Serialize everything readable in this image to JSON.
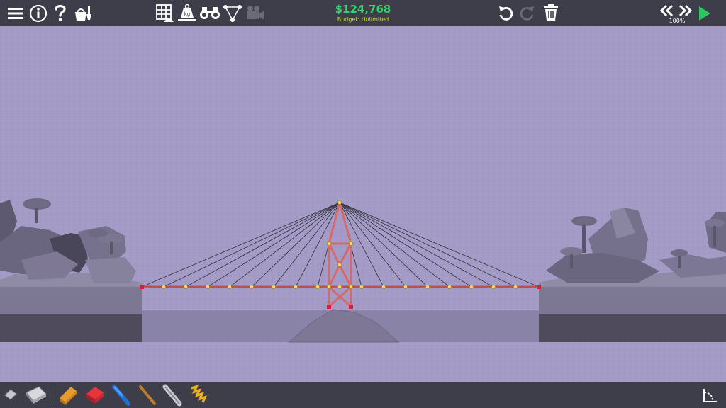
{
  "toolbar": {
    "budget_amount": "$124,768",
    "budget_label": "Budget: Unlimited",
    "speed": "100%"
  },
  "colors": {
    "bar_bg": "#3e3d4a",
    "sky": "#a49cc6",
    "road": "#c0504d",
    "steel": "#d46a6a",
    "joint": "#f1e23a",
    "anchor": "#d2233e",
    "cable": "#3a3a48",
    "budget": "#34d16a",
    "play": "#2fc55e"
  },
  "top_icons_left": [
    "menu-icon",
    "info-icon",
    "help-icon",
    "sandbox-icon"
  ],
  "top_icons_center": [
    "grid-icon",
    "weight-icon",
    "binoculars-icon",
    "joints-icon",
    "camera-icon"
  ],
  "top_icons_right": [
    "undo-icon",
    "redo-icon",
    "trash-icon",
    "slow-down-icon",
    "speed-up-icon",
    "play-icon"
  ],
  "materials": [
    "eraser-tool",
    "eraser-all-tool",
    "road-material",
    "reinforced-road-material",
    "hydraulic-material",
    "wood-material",
    "steel-material",
    "spring-material"
  ]
}
